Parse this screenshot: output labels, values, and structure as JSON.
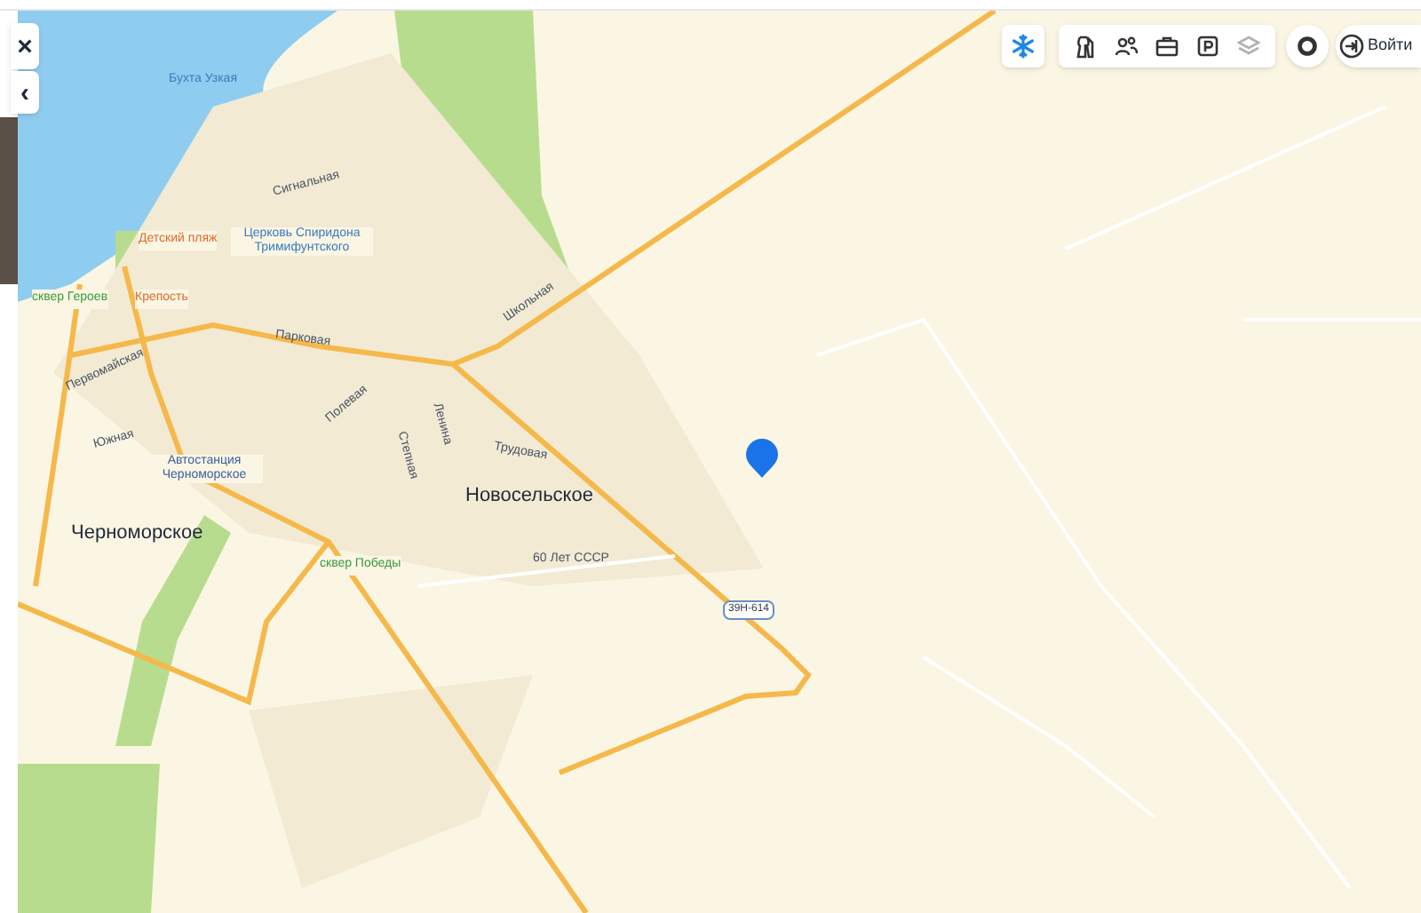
{
  "side_panel": {
    "close_label": "×",
    "collapse_label": "‹"
  },
  "toolbar": {
    "winter_mode_on": true,
    "tools": [
      {
        "disabled": false
      },
      {
        "disabled": false
      },
      {
        "disabled": false
      },
      {
        "disabled": false
      },
      {
        "disabled": true
      }
    ],
    "login_label": "Войти"
  },
  "map": {
    "labels": [
      {
        "kind": "water",
        "text": "Бухта Узкая"
      },
      {
        "kind": "poi",
        "text": "Детский пляж"
      },
      {
        "kind": "church",
        "text": "Церковь Спиридона Тримифунтского"
      },
      {
        "kind": "street",
        "text": "Сигнальная"
      },
      {
        "kind": "park",
        "text": "сквер Героев"
      },
      {
        "kind": "poi",
        "text": "Крепость"
      },
      {
        "kind": "street",
        "text": "Парковая"
      },
      {
        "kind": "street",
        "text": "Школьная"
      },
      {
        "kind": "street",
        "text": "Первомайская"
      },
      {
        "kind": "street",
        "text": "Южная"
      },
      {
        "kind": "bus",
        "text": "Автостанция Черноморское"
      },
      {
        "kind": "street",
        "text": "Полевая"
      },
      {
        "kind": "street",
        "text": "Степная"
      },
      {
        "kind": "street",
        "text": "Ленина"
      },
      {
        "kind": "street",
        "text": "Трудовая"
      },
      {
        "kind": "town",
        "text": "Новосельское"
      },
      {
        "kind": "town",
        "text": "Черноморское"
      },
      {
        "kind": "park",
        "text": "сквер Победы"
      },
      {
        "kind": "street",
        "text": "60 Лет СССР"
      },
      {
        "kind": "shield",
        "text": "39Н-614"
      }
    ]
  }
}
